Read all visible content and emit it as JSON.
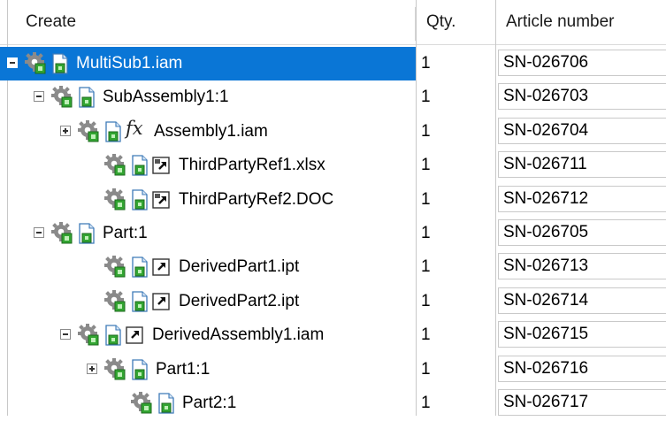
{
  "header": {
    "create": "Create",
    "qty": "Qty.",
    "article_number": "Article number"
  },
  "colors": {
    "selection": "#0a76d6",
    "gear_green": "#33a532",
    "gear_blue": "#3d7ab8"
  },
  "rows": [
    {
      "name": "MultiSub1.iam",
      "level": 0,
      "toggle": "minus",
      "extra": null,
      "qty": "1",
      "article": "SN-026706",
      "selected": true
    },
    {
      "name": "SubAssembly1:1",
      "level": 1,
      "toggle": "minus",
      "extra": null,
      "qty": "1",
      "article": "SN-026703",
      "selected": false
    },
    {
      "name": "Assembly1.iam",
      "level": 2,
      "toggle": "plus",
      "extra": "fx",
      "qty": "1",
      "article": "SN-026704",
      "selected": false
    },
    {
      "name": "ThirdPartyRef1.xlsx",
      "level": 3,
      "toggle": null,
      "extra": "thirdparty",
      "qty": "1",
      "article": "SN-026711",
      "selected": false
    },
    {
      "name": "ThirdPartyRef2.DOC",
      "level": 3,
      "toggle": null,
      "extra": "thirdparty",
      "qty": "1",
      "article": "SN-026712",
      "selected": false
    },
    {
      "name": "Part:1",
      "level": 1,
      "toggle": "minus",
      "extra": null,
      "qty": "1",
      "article": "SN-026705",
      "selected": false
    },
    {
      "name": "DerivedPart1.ipt",
      "level": 3,
      "toggle": null,
      "extra": "derived",
      "qty": "1",
      "article": "SN-026713",
      "selected": false
    },
    {
      "name": "DerivedPart2.ipt",
      "level": 3,
      "toggle": null,
      "extra": "derived",
      "qty": "1",
      "article": "SN-026714",
      "selected": false
    },
    {
      "name": "DerivedAssembly1.iam",
      "level": 2,
      "toggle": "minus",
      "extra": "derived",
      "qty": "1",
      "article": "SN-026715",
      "selected": false
    },
    {
      "name": "Part1:1",
      "level": 3,
      "toggle": "plus",
      "extra": null,
      "qty": "1",
      "article": "SN-026716",
      "selected": false
    },
    {
      "name": "Part2:1",
      "level": 4,
      "toggle": null,
      "extra": null,
      "qty": "1",
      "article": "SN-026717",
      "selected": false
    }
  ]
}
